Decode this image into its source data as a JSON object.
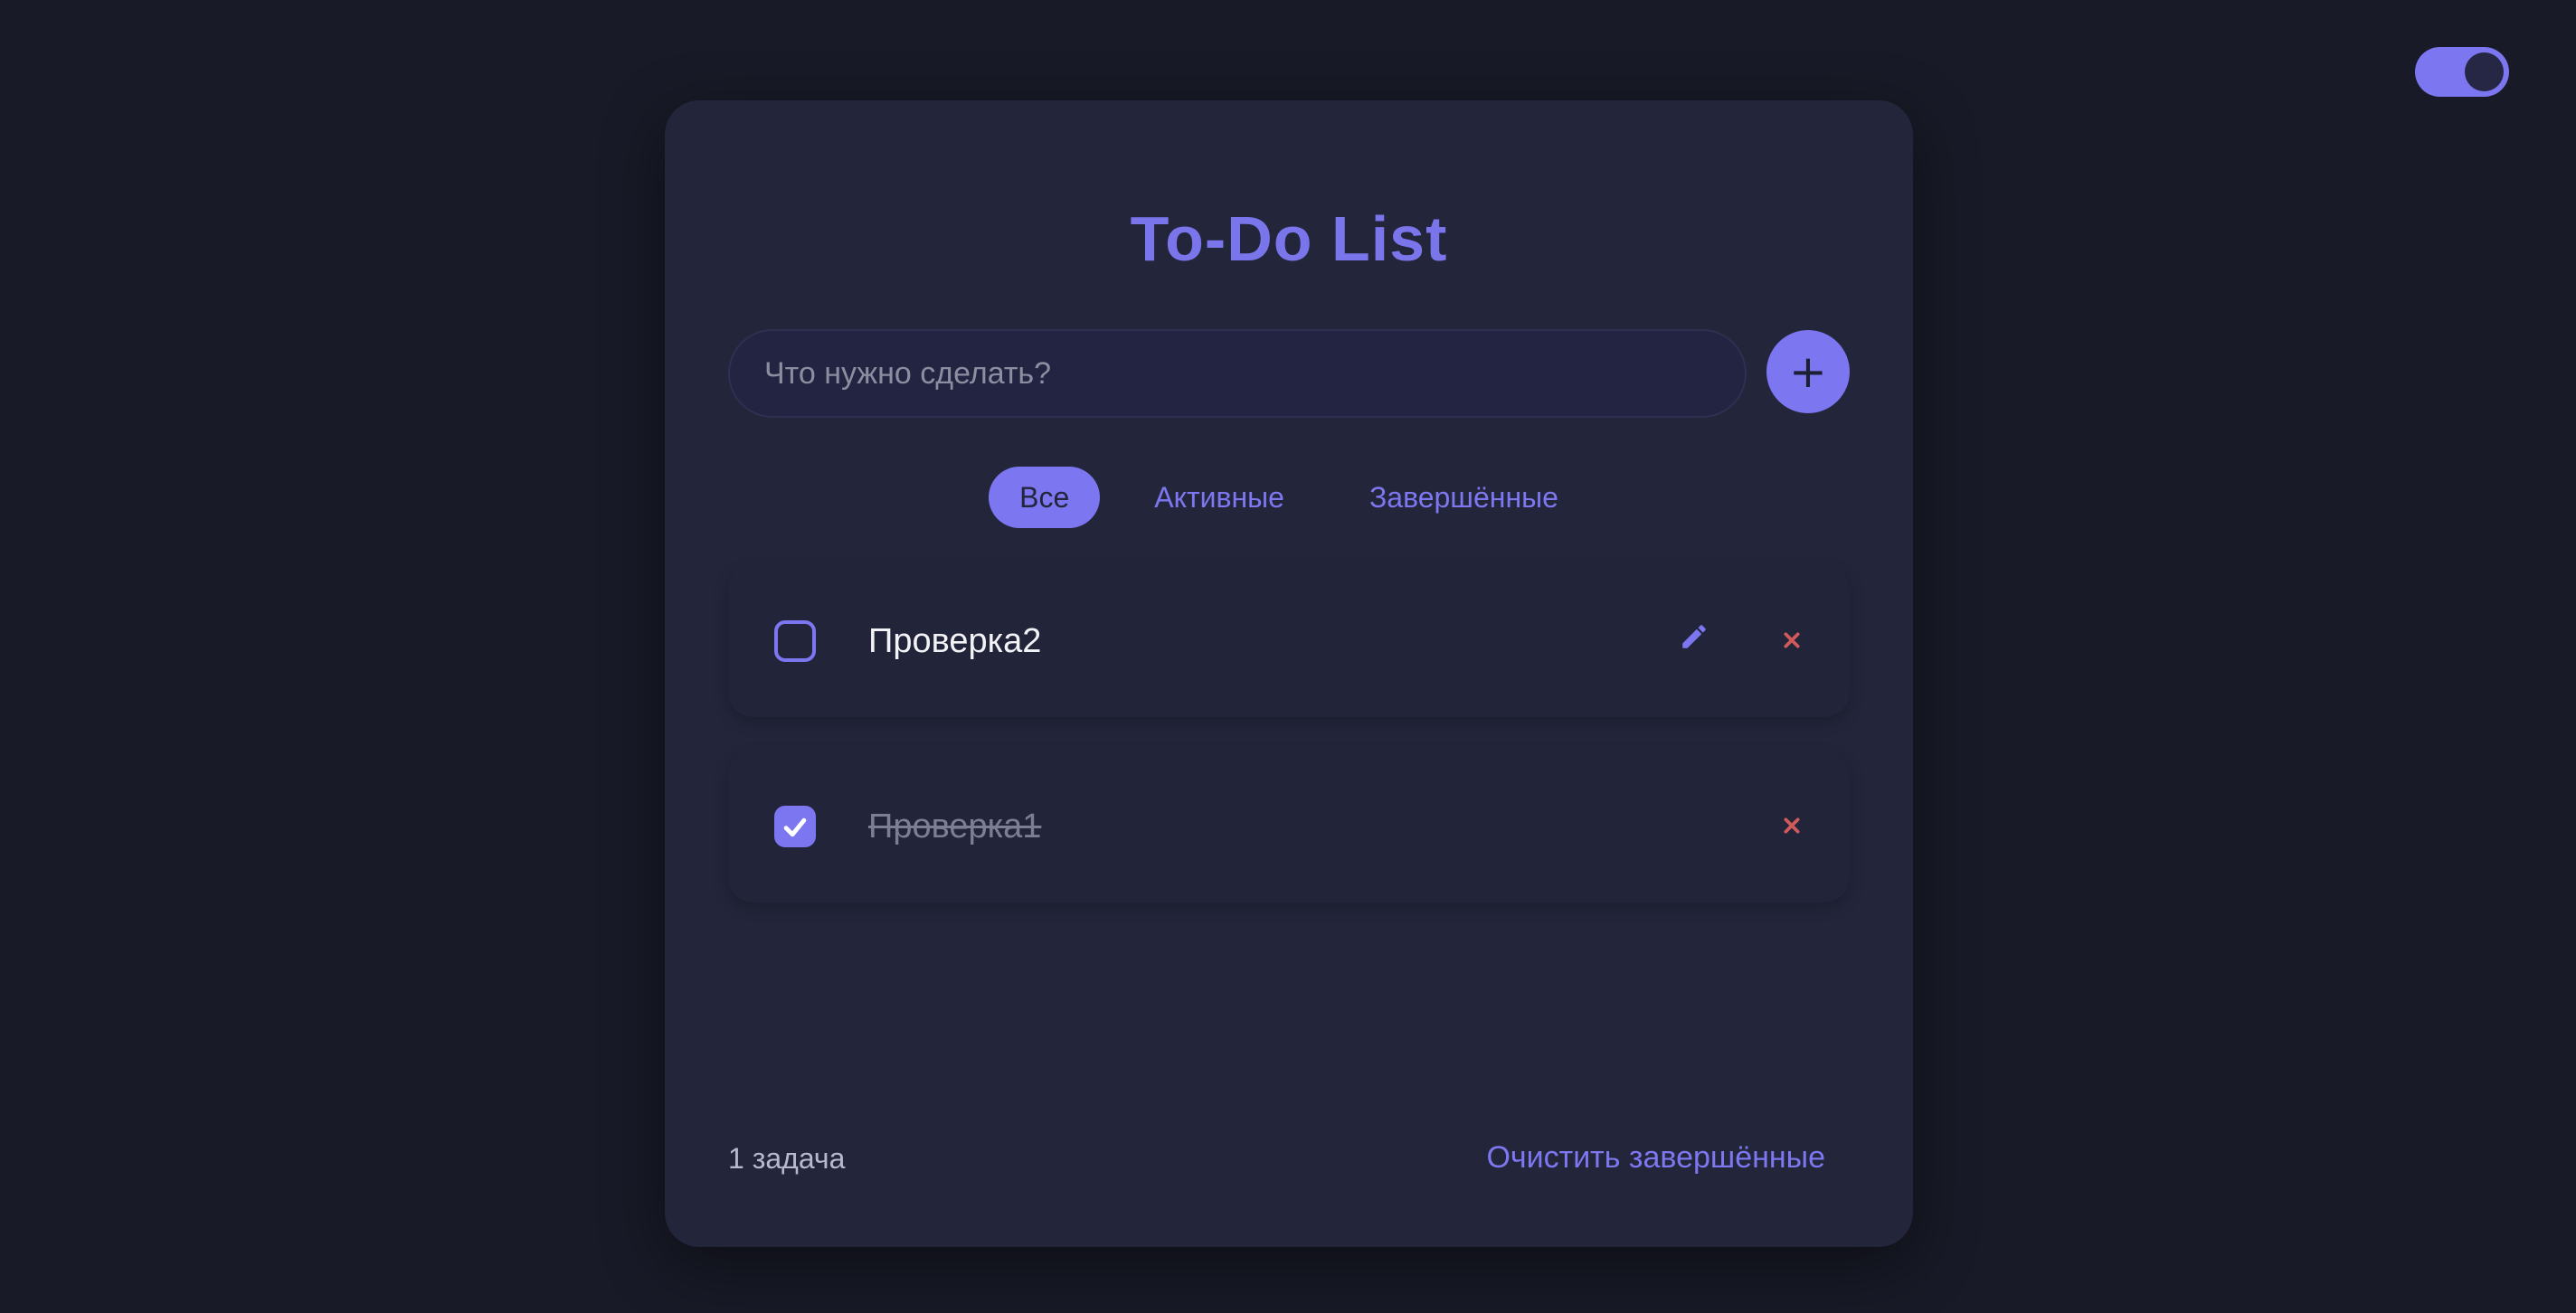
{
  "app": {
    "title": "To-Do List"
  },
  "input": {
    "placeholder": "Что нужно сделать?",
    "value": ""
  },
  "add_button": {
    "label": "+"
  },
  "filters": [
    {
      "label": "Все",
      "active": true
    },
    {
      "label": "Активные",
      "active": false
    },
    {
      "label": "Завершённые",
      "active": false
    }
  ],
  "todos": [
    {
      "text": "Проверка2",
      "completed": false,
      "actions": [
        "pencil-icon",
        "close-icon"
      ]
    },
    {
      "text": "Проверка1",
      "completed": true,
      "actions": [
        "close-icon"
      ]
    }
  ],
  "footer": {
    "count_label": "1 задача",
    "clear_label": "Очистить завершённые"
  },
  "theme_toggle": {
    "on": true
  },
  "colors": {
    "background": "#181a27",
    "card": "#23253b",
    "accent": "#7c76f1",
    "danger": "#d05a5a",
    "text": "#f3f3f7",
    "muted": "#7c7e94"
  },
  "icons": {
    "add": "plus-icon",
    "edit": "pencil-icon",
    "delete": "close-icon",
    "check": "checkmark-icon"
  }
}
